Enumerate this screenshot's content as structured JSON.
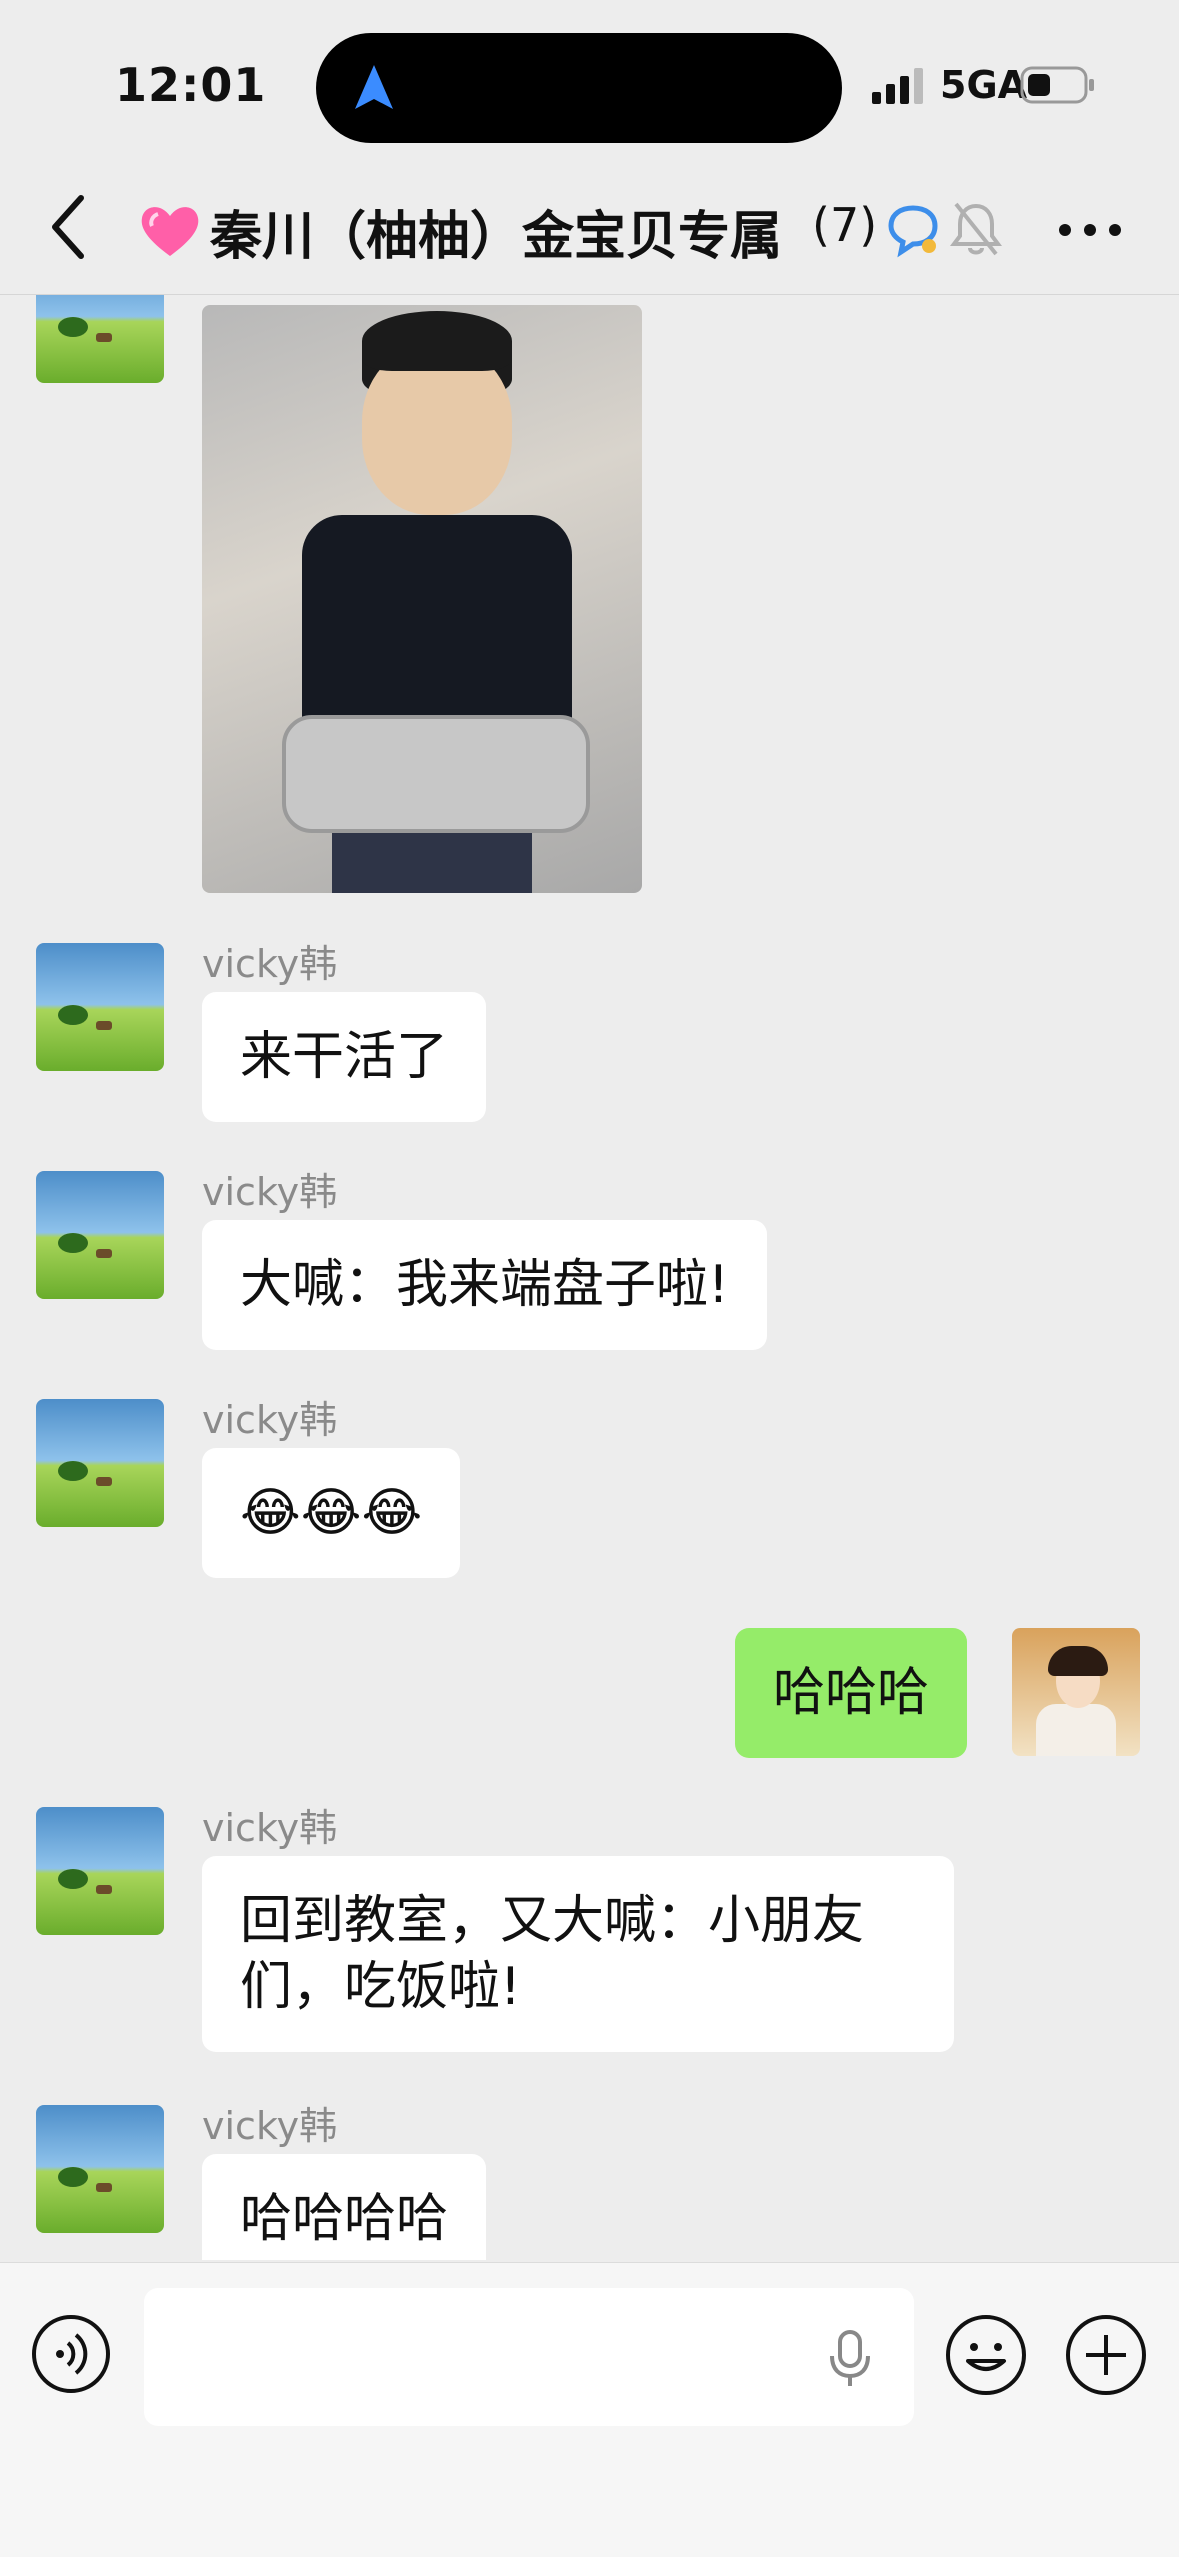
{
  "status_bar": {
    "time": "12:01",
    "network": "5GA"
  },
  "header": {
    "title": "秦川（柚柚）金宝贝专属",
    "member_count": "(7)"
  },
  "messages": [
    {
      "sender": "",
      "type": "image",
      "image_desc": "photo"
    },
    {
      "sender": "vicky韩",
      "type": "text",
      "text": "来干活了"
    },
    {
      "sender": "vicky韩",
      "type": "text",
      "text": "大喊：我来端盘子啦!"
    },
    {
      "sender": "vicky韩",
      "type": "text",
      "text": "😂😂😂"
    },
    {
      "sender": "me",
      "type": "text",
      "text": "哈哈哈"
    },
    {
      "sender": "vicky韩",
      "type": "text",
      "text": "回到教室，又大喊：小朋友们，吃饭啦!"
    },
    {
      "sender": "vicky韩",
      "type": "text",
      "text": "哈哈哈哈"
    }
  ],
  "colors": {
    "my_bubble": "#95ec69",
    "other_bubble": "#ffffff",
    "background": "#ededed"
  }
}
